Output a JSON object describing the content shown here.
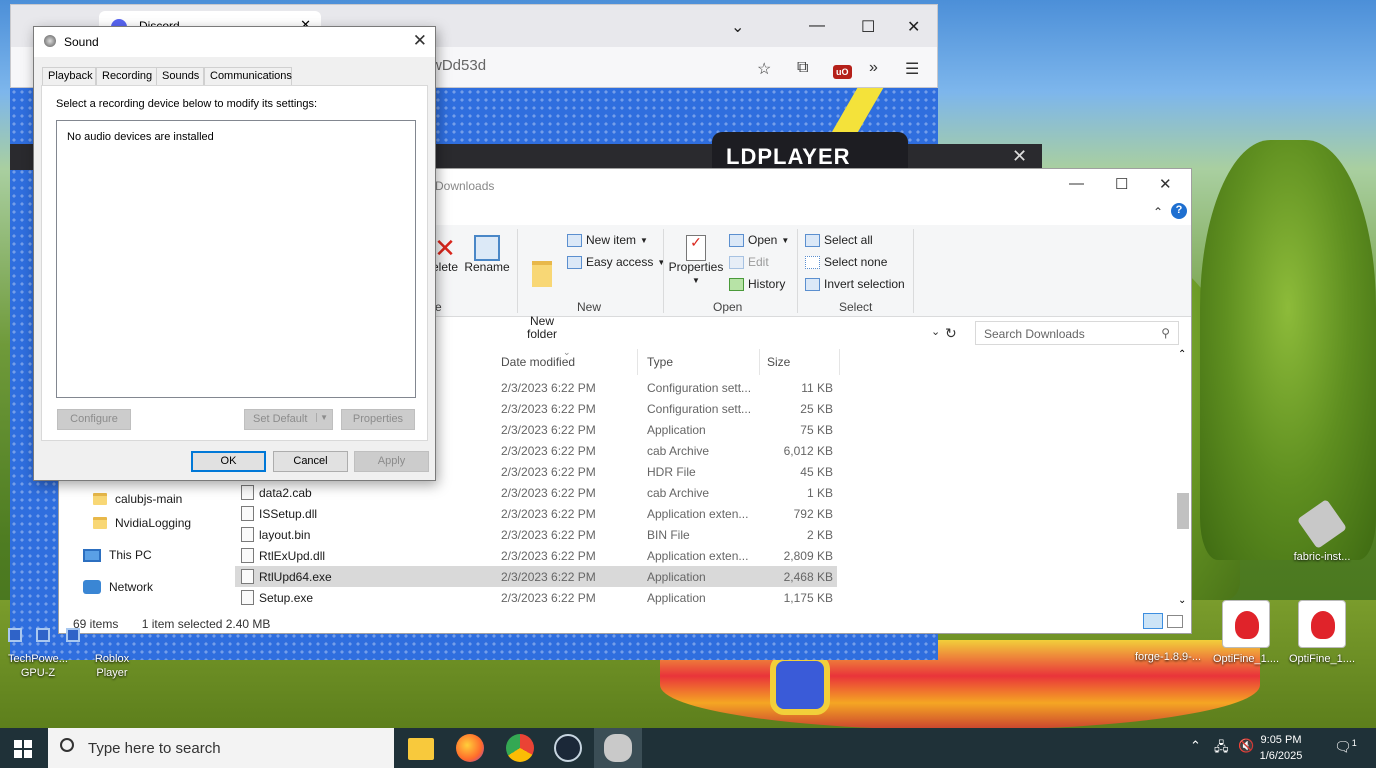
{
  "browser": {
    "tab_title": "Discord",
    "url_fragment": "wDd53d"
  },
  "ldplayer": {
    "logo_text": "LDPLAYER"
  },
  "explorer": {
    "title": "Downloads",
    "ribbon": {
      "delete_label": "elete",
      "rename_label": "Rename",
      "new_folder_label": "New\nfolder",
      "new_item_label": "New item",
      "easy_access_label": "Easy access",
      "new_group": "New",
      "properties_label": "Properties",
      "open_label": "Open",
      "edit_label": "Edit",
      "history_label": "History",
      "open_group": "Open",
      "select_all_label": "Select all",
      "select_none_label": "Select none",
      "invert_selection_label": "Invert selection",
      "select_group": "Select",
      "organize_group": "e"
    },
    "search_placeholder": "Search Downloads",
    "columns": {
      "date": "Date modified",
      "type": "Type",
      "size": "Size"
    },
    "rows": [
      {
        "name": "",
        "date": "2/3/2023 6:22 PM",
        "type": "Configuration sett...",
        "size": "11 KB"
      },
      {
        "name": "",
        "date": "2/3/2023 6:22 PM",
        "type": "Configuration sett...",
        "size": "25 KB"
      },
      {
        "name": "",
        "date": "2/3/2023 6:22 PM",
        "type": "Application",
        "size": "75 KB"
      },
      {
        "name": "",
        "date": "2/3/2023 6:22 PM",
        "type": "cab Archive",
        "size": "6,012 KB"
      },
      {
        "name": "",
        "date": "2/3/2023 6:22 PM",
        "type": "HDR File",
        "size": "45 KB"
      },
      {
        "name": "data2.cab",
        "date": "2/3/2023 6:22 PM",
        "type": "cab Archive",
        "size": "1 KB"
      },
      {
        "name": "ISSetup.dll",
        "date": "2/3/2023 6:22 PM",
        "type": "Application exten...",
        "size": "792 KB"
      },
      {
        "name": "layout.bin",
        "date": "2/3/2023 6:22 PM",
        "type": "BIN File",
        "size": "2 KB"
      },
      {
        "name": "RtlExUpd.dll",
        "date": "2/3/2023 6:22 PM",
        "type": "Application exten...",
        "size": "2,809 KB"
      },
      {
        "name": "RtlUpd64.exe",
        "date": "2/3/2023 6:22 PM",
        "type": "Application",
        "size": "2,468 KB"
      },
      {
        "name": "Setup.exe",
        "date": "2/3/2023 6:22 PM",
        "type": "Application",
        "size": "1,175 KB"
      }
    ],
    "nav": {
      "folder1": "calubjs-main",
      "folder2": "NvidiaLogging",
      "this_pc": "This PC",
      "network": "Network"
    },
    "status": {
      "count": "69 items",
      "selected": "1 item selected  2.40 MB"
    }
  },
  "sound": {
    "title": "Sound",
    "tabs": [
      "Playback",
      "Recording",
      "Sounds",
      "Communications"
    ],
    "instruction": "Select a recording device below to modify its settings:",
    "empty_message": "No audio devices are installed",
    "configure": "Configure",
    "set_default": "Set Default",
    "properties": "Properties",
    "ok": "OK",
    "cancel": "Cancel",
    "apply": "Apply"
  },
  "desktop_icons": {
    "gpuz": "TechPowe...\nGPU-Z",
    "roblox": "Roblox\nPlayer",
    "fabric": "fabric-inst...",
    "forge": "forge-1.8.9-...",
    "optifine1": "OptiFine_1....",
    "optifine2": "OptiFine_1...."
  },
  "taskbar": {
    "search_placeholder": "Type here to search",
    "time": "9:05 PM",
    "date": "1/6/2025",
    "notif_count": "1"
  }
}
